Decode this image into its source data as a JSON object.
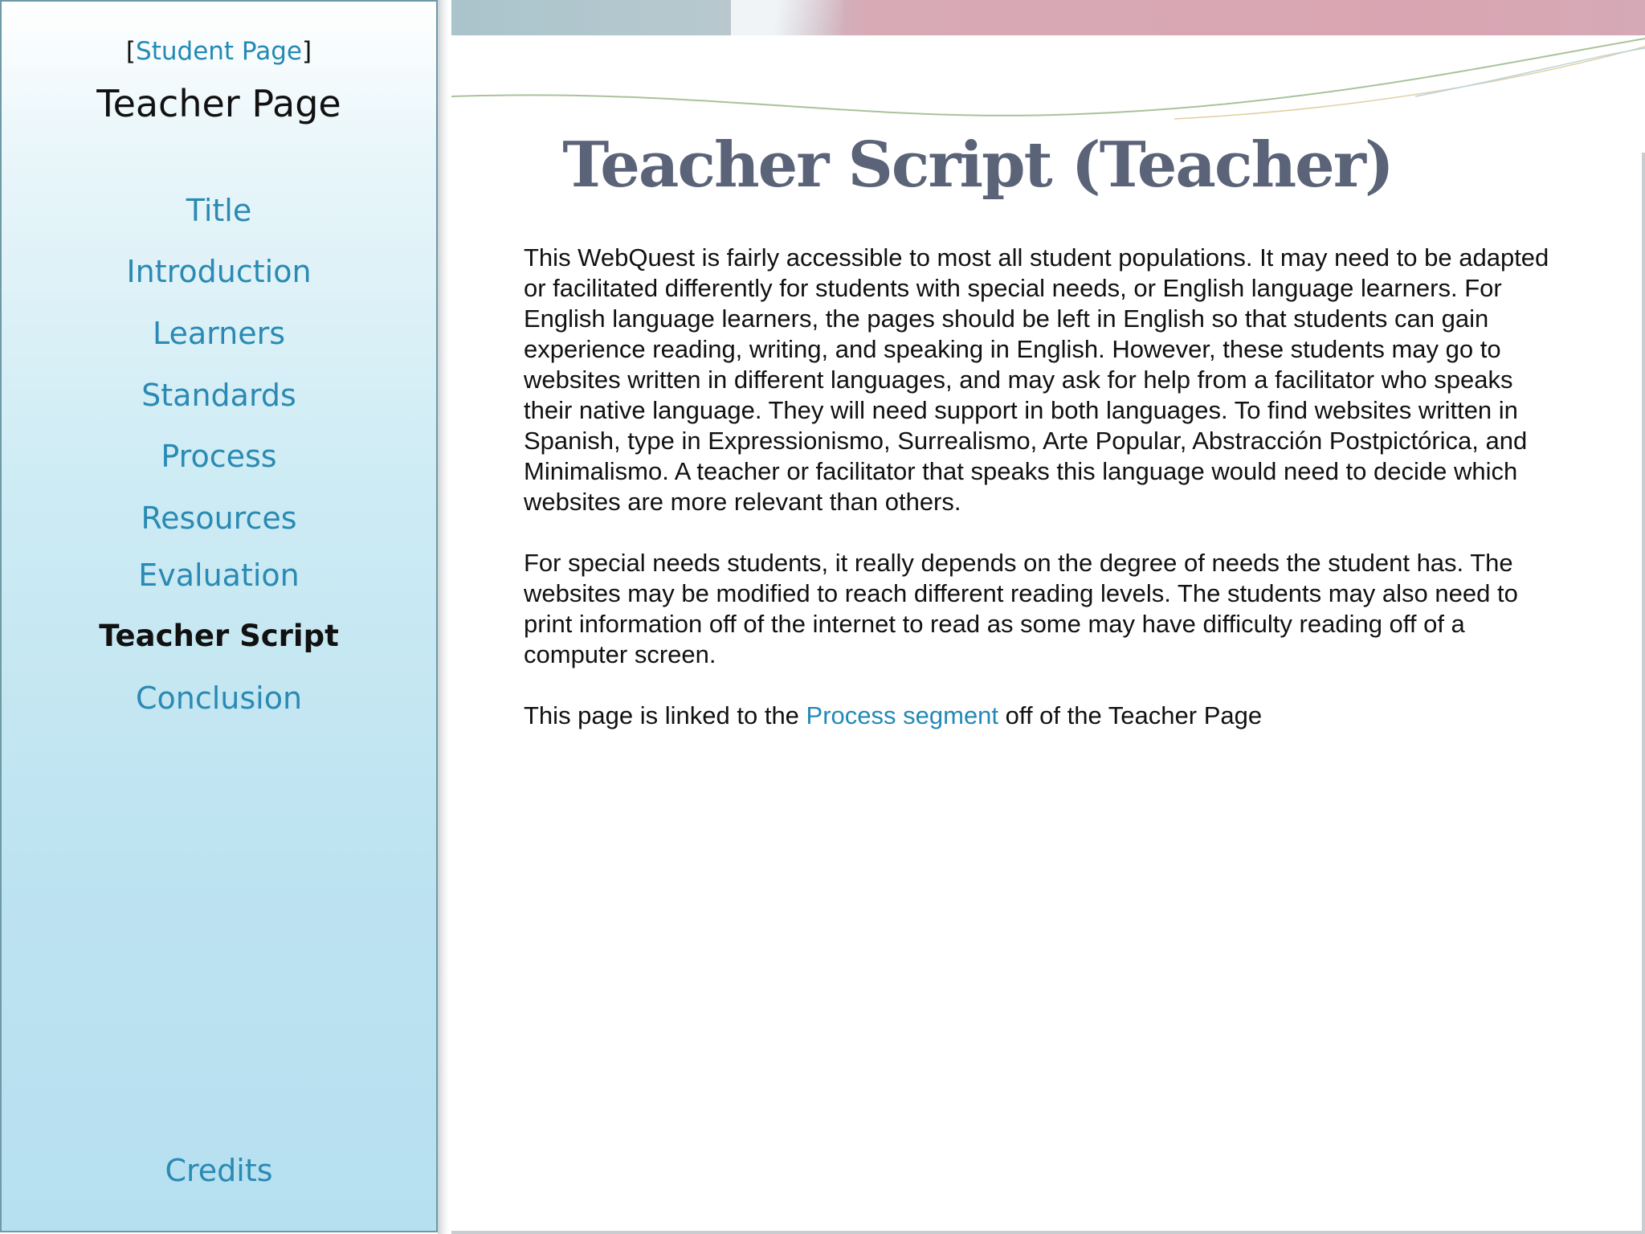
{
  "sidebar": {
    "student_link_prefix": "[",
    "student_link_label": "Student Page",
    "student_link_suffix": "]",
    "title": "Teacher Page",
    "items": [
      {
        "label": "Title"
      },
      {
        "label": "Introduction"
      },
      {
        "label": "Learners"
      },
      {
        "label": "Standards"
      },
      {
        "label": "Process"
      },
      {
        "label": "Resources"
      },
      {
        "label": "Evaluation"
      },
      {
        "label": "Teacher Script"
      },
      {
        "label": "Conclusion"
      },
      {
        "label": "Credits"
      }
    ],
    "active_item": "Teacher Script"
  },
  "main": {
    "title": "Teacher Script (Teacher)",
    "paragraph1": "This WebQuest is fairly accessible to most all student populations. It may need to be adapted or facilitated differently for students with special needs, or  English language learners. For English language learners, the pages should be left in English so that students can gain experience reading, writing, and speaking in English. However, these students may go to websites written in different languages, and may ask for help from a facilitator who speaks their native language. They will need support in both languages.  To find websites written in Spanish, type in Expressionismo, Surrealismo, Arte Popular, Abstracción Postpictórica, and Minimalismo. A teacher or facilitator that speaks this language would need to decide which websites are more relevant than others.",
    "paragraph2": "For special needs students, it really depends on the degree of needs the student has. The websites may be modified to reach different reading levels. The students may also need to print information off of the internet to read as some may have difficulty reading off of a computer screen.",
    "paragraph3_before": "This page is linked to the ",
    "paragraph3_link": "Process segment",
    "paragraph3_after": " off of the Teacher Page"
  },
  "colors": {
    "link": "#2389b5",
    "title": "#5a6378",
    "sidebar_bg": "#bde3f1"
  }
}
